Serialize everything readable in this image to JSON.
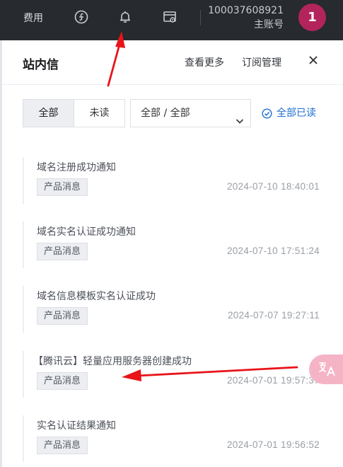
{
  "topbar": {
    "cost_label": "费用",
    "account_id": "100037608921",
    "account_role": "主账号",
    "avatar_text": "1",
    "icons": [
      "finance-icon",
      "bell-icon",
      "console-settings-icon"
    ]
  },
  "panel": {
    "title": "站内信",
    "more_label": "查看更多",
    "subscribe_label": "订阅管理",
    "close_icon": "close-icon"
  },
  "filters": {
    "all_label": "全部",
    "unread_label": "未读",
    "category_value": "全部 / 全部",
    "mark_all_read_label": "全部已读"
  },
  "messages": [
    {
      "title": "域名注册成功通知",
      "tag": "产品消息",
      "time": "2024-07-10 18:40:01"
    },
    {
      "title": "域名实名认证成功通知",
      "tag": "产品消息",
      "time": "2024-07-10 17:51:24"
    },
    {
      "title": "域名信息模板实名认证成功",
      "tag": "产品消息",
      "time": "2024-07-07 19:27:11"
    },
    {
      "title": "【腾讯云】轻量应用服务器创建成功",
      "tag": "产品消息",
      "time": "2024-07-01 19:57:37"
    },
    {
      "title": "实名认证结果通知",
      "tag": "产品消息",
      "time": "2024-07-01 19:56:52"
    }
  ],
  "colors": {
    "topbar_bg": "#272a2e",
    "avatar_bg": "#b3245c",
    "link_blue": "#1f6ed4",
    "arrow_red": "#e8141a",
    "translate_bg": "#f5b4c6"
  }
}
